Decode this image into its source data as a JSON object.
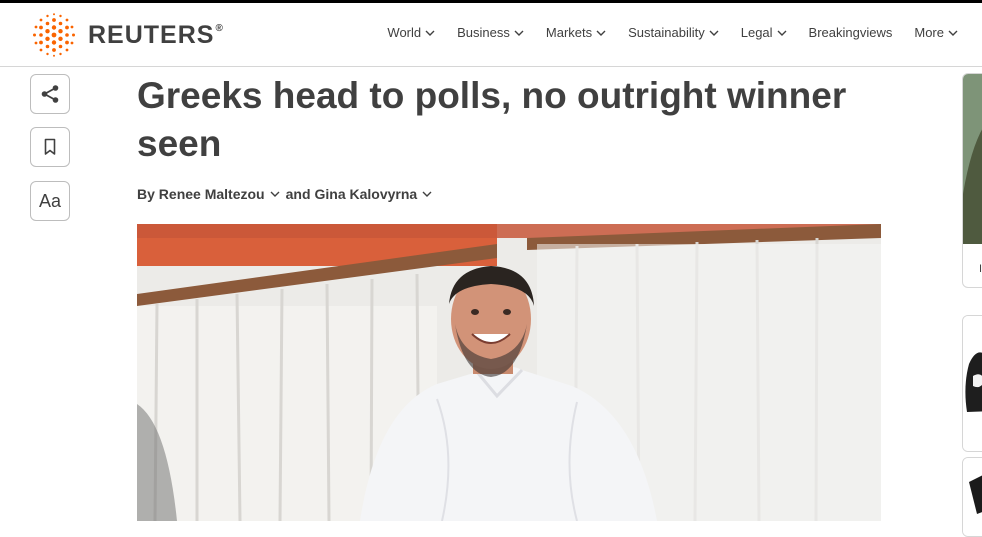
{
  "brand": {
    "name": "REUTERS",
    "registered": "®"
  },
  "nav": {
    "items": [
      {
        "label": "World",
        "has_dropdown": true
      },
      {
        "label": "Business",
        "has_dropdown": true
      },
      {
        "label": "Markets",
        "has_dropdown": true
      },
      {
        "label": "Sustainability",
        "has_dropdown": true
      },
      {
        "label": "Legal",
        "has_dropdown": true
      },
      {
        "label": "Breakingviews",
        "has_dropdown": false
      },
      {
        "label": "More",
        "has_dropdown": true
      }
    ]
  },
  "toolbar": {
    "share_icon": "share-icon",
    "bookmark_icon": "bookmark-icon",
    "text_size_label": "Aa"
  },
  "article": {
    "headline": "Greeks head to polls, no outright winner seen",
    "byline_prefix": "By",
    "authors": [
      "Renee Maltezou",
      "Gina Kalovyrna"
    ],
    "byline_join": "and"
  },
  "rail": {
    "card1_label": "I"
  },
  "colors": {
    "brand_orange": "#fa6400",
    "text": "#404040",
    "border": "#d6d6d6"
  }
}
